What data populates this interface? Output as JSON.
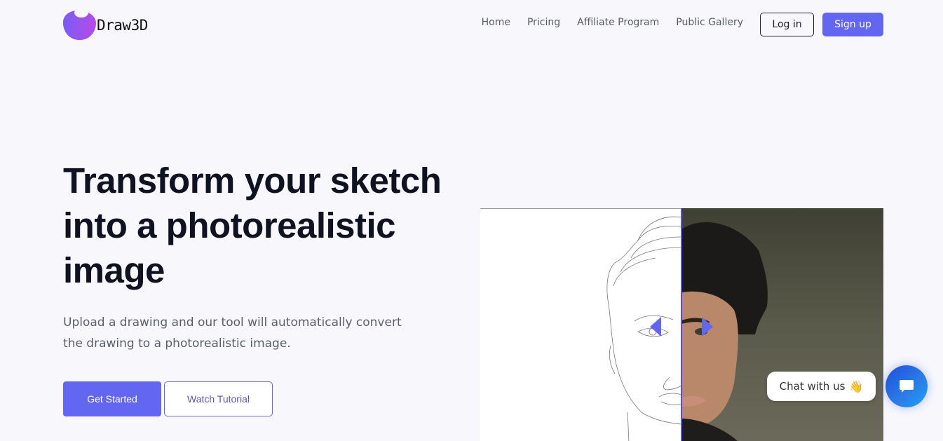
{
  "brand": {
    "name": "Draw3D",
    "logo_gradient": [
      "#7b5cf5",
      "#b64be8"
    ]
  },
  "nav": {
    "links": [
      {
        "label": "Home"
      },
      {
        "label": "Pricing"
      },
      {
        "label": "Affiliate Program"
      },
      {
        "label": "Public Gallery"
      }
    ],
    "login_label": "Log in",
    "signup_label": "Sign up"
  },
  "hero": {
    "title": "Transform your sketch into a photorealistic image",
    "subtitle": "Upload a drawing and our tool will automatically convert the drawing to a photorealistic image.",
    "cta_primary": "Get Started",
    "cta_secondary": "Watch Tutorial"
  },
  "comparison": {
    "left_label": "sketch",
    "right_label": "photo",
    "accent": "#6366f1"
  },
  "chat": {
    "bubble_text": "Chat with us",
    "bubble_emoji": "👋",
    "fab_icon": "chat-icon"
  },
  "colors": {
    "accent": "#6366f1",
    "background": "#f8f8fc",
    "heading": "#0f1220",
    "body_text": "#5a5f6b"
  }
}
